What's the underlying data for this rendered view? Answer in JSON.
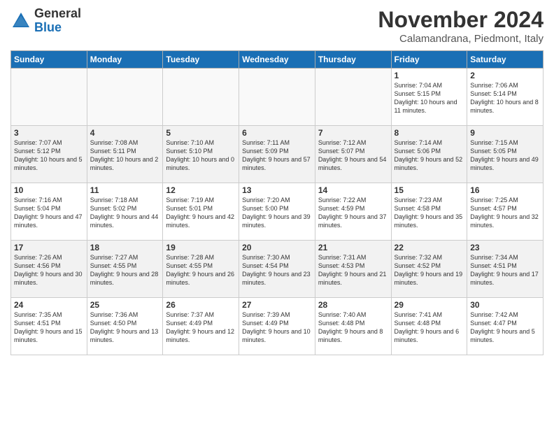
{
  "logo": {
    "general": "General",
    "blue": "Blue"
  },
  "title": "November 2024",
  "subtitle": "Calamandrana, Piedmont, Italy",
  "days": [
    "Sunday",
    "Monday",
    "Tuesday",
    "Wednesday",
    "Thursday",
    "Friday",
    "Saturday"
  ],
  "weeks": [
    [
      {
        "day": "",
        "info": ""
      },
      {
        "day": "",
        "info": ""
      },
      {
        "day": "",
        "info": ""
      },
      {
        "day": "",
        "info": ""
      },
      {
        "day": "",
        "info": ""
      },
      {
        "day": "1",
        "info": "Sunrise: 7:04 AM\nSunset: 5:15 PM\nDaylight: 10 hours and 11 minutes."
      },
      {
        "day": "2",
        "info": "Sunrise: 7:06 AM\nSunset: 5:14 PM\nDaylight: 10 hours and 8 minutes."
      }
    ],
    [
      {
        "day": "3",
        "info": "Sunrise: 7:07 AM\nSunset: 5:12 PM\nDaylight: 10 hours and 5 minutes."
      },
      {
        "day": "4",
        "info": "Sunrise: 7:08 AM\nSunset: 5:11 PM\nDaylight: 10 hours and 2 minutes."
      },
      {
        "day": "5",
        "info": "Sunrise: 7:10 AM\nSunset: 5:10 PM\nDaylight: 10 hours and 0 minutes."
      },
      {
        "day": "6",
        "info": "Sunrise: 7:11 AM\nSunset: 5:09 PM\nDaylight: 9 hours and 57 minutes."
      },
      {
        "day": "7",
        "info": "Sunrise: 7:12 AM\nSunset: 5:07 PM\nDaylight: 9 hours and 54 minutes."
      },
      {
        "day": "8",
        "info": "Sunrise: 7:14 AM\nSunset: 5:06 PM\nDaylight: 9 hours and 52 minutes."
      },
      {
        "day": "9",
        "info": "Sunrise: 7:15 AM\nSunset: 5:05 PM\nDaylight: 9 hours and 49 minutes."
      }
    ],
    [
      {
        "day": "10",
        "info": "Sunrise: 7:16 AM\nSunset: 5:04 PM\nDaylight: 9 hours and 47 minutes."
      },
      {
        "day": "11",
        "info": "Sunrise: 7:18 AM\nSunset: 5:02 PM\nDaylight: 9 hours and 44 minutes."
      },
      {
        "day": "12",
        "info": "Sunrise: 7:19 AM\nSunset: 5:01 PM\nDaylight: 9 hours and 42 minutes."
      },
      {
        "day": "13",
        "info": "Sunrise: 7:20 AM\nSunset: 5:00 PM\nDaylight: 9 hours and 39 minutes."
      },
      {
        "day": "14",
        "info": "Sunrise: 7:22 AM\nSunset: 4:59 PM\nDaylight: 9 hours and 37 minutes."
      },
      {
        "day": "15",
        "info": "Sunrise: 7:23 AM\nSunset: 4:58 PM\nDaylight: 9 hours and 35 minutes."
      },
      {
        "day": "16",
        "info": "Sunrise: 7:25 AM\nSunset: 4:57 PM\nDaylight: 9 hours and 32 minutes."
      }
    ],
    [
      {
        "day": "17",
        "info": "Sunrise: 7:26 AM\nSunset: 4:56 PM\nDaylight: 9 hours and 30 minutes."
      },
      {
        "day": "18",
        "info": "Sunrise: 7:27 AM\nSunset: 4:55 PM\nDaylight: 9 hours and 28 minutes."
      },
      {
        "day": "19",
        "info": "Sunrise: 7:28 AM\nSunset: 4:55 PM\nDaylight: 9 hours and 26 minutes."
      },
      {
        "day": "20",
        "info": "Sunrise: 7:30 AM\nSunset: 4:54 PM\nDaylight: 9 hours and 23 minutes."
      },
      {
        "day": "21",
        "info": "Sunrise: 7:31 AM\nSunset: 4:53 PM\nDaylight: 9 hours and 21 minutes."
      },
      {
        "day": "22",
        "info": "Sunrise: 7:32 AM\nSunset: 4:52 PM\nDaylight: 9 hours and 19 minutes."
      },
      {
        "day": "23",
        "info": "Sunrise: 7:34 AM\nSunset: 4:51 PM\nDaylight: 9 hours and 17 minutes."
      }
    ],
    [
      {
        "day": "24",
        "info": "Sunrise: 7:35 AM\nSunset: 4:51 PM\nDaylight: 9 hours and 15 minutes."
      },
      {
        "day": "25",
        "info": "Sunrise: 7:36 AM\nSunset: 4:50 PM\nDaylight: 9 hours and 13 minutes."
      },
      {
        "day": "26",
        "info": "Sunrise: 7:37 AM\nSunset: 4:49 PM\nDaylight: 9 hours and 12 minutes."
      },
      {
        "day": "27",
        "info": "Sunrise: 7:39 AM\nSunset: 4:49 PM\nDaylight: 9 hours and 10 minutes."
      },
      {
        "day": "28",
        "info": "Sunrise: 7:40 AM\nSunset: 4:48 PM\nDaylight: 9 hours and 8 minutes."
      },
      {
        "day": "29",
        "info": "Sunrise: 7:41 AM\nSunset: 4:48 PM\nDaylight: 9 hours and 6 minutes."
      },
      {
        "day": "30",
        "info": "Sunrise: 7:42 AM\nSunset: 4:47 PM\nDaylight: 9 hours and 5 minutes."
      }
    ]
  ]
}
